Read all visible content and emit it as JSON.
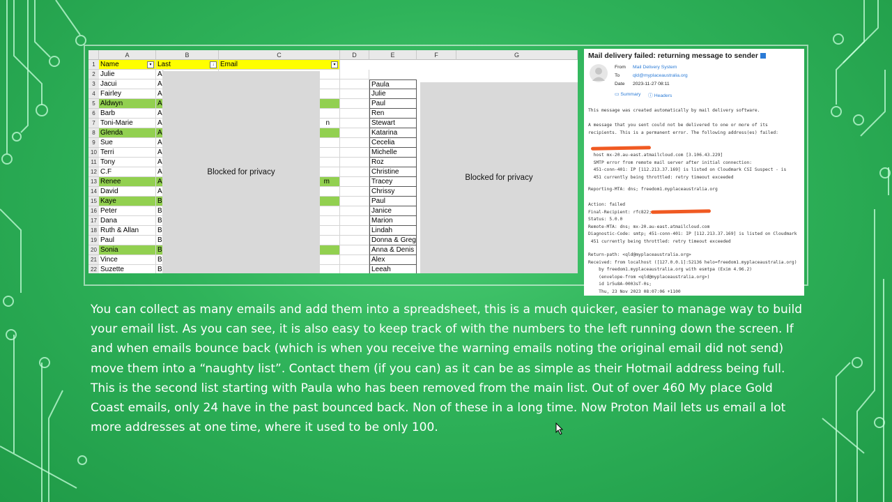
{
  "sheet": {
    "columns": [
      "A",
      "B",
      "C",
      "D",
      "E",
      "F",
      "G"
    ],
    "headers": {
      "name": "Name",
      "last": "Last",
      "email": "Email"
    },
    "rows": [
      {
        "n": "2",
        "a": "Julie",
        "b": "Al"
      },
      {
        "n": "3",
        "a": "Jacui",
        "b": "Ai"
      },
      {
        "n": "4",
        "a": "Fairley",
        "b": "Ai"
      },
      {
        "n": "5",
        "a": "Aldwyn",
        "b": "Al"
      },
      {
        "n": "6",
        "a": "Barb",
        "b": "Ar"
      },
      {
        "n": "7",
        "a": "Toni-Marie",
        "b": "Ar"
      },
      {
        "n": "8",
        "a": "Glenda",
        "b": "Ai"
      },
      {
        "n": "9",
        "a": "Sue",
        "b": "Ai"
      },
      {
        "n": "10",
        "a": "Terri",
        "b": "Ai"
      },
      {
        "n": "11",
        "a": "Tony",
        "b": "Ai"
      },
      {
        "n": "12",
        "a": "C.F",
        "b": "Ai"
      },
      {
        "n": "13",
        "a": "Renee",
        "b": "At"
      },
      {
        "n": "14",
        "a": "David",
        "b": "A"
      },
      {
        "n": "15",
        "a": "Kaye",
        "b": "B"
      },
      {
        "n": "16",
        "a": "Peter",
        "b": "B"
      },
      {
        "n": "17",
        "a": "Dana",
        "b": "B"
      },
      {
        "n": "18",
        "a": "Ruth & Allan",
        "b": "B"
      },
      {
        "n": "19",
        "a": "Paul",
        "b": "B"
      },
      {
        "n": "20",
        "a": "Sonia",
        "b": "Ba"
      },
      {
        "n": "21",
        "a": "Vince",
        "b": "B"
      },
      {
        "n": "22",
        "a": "Suzette",
        "b": "B"
      }
    ],
    "c_tail": {
      "7": "n",
      "13": "m"
    },
    "second_list": [
      "Paula",
      "Julie",
      "Paul",
      "Ren",
      "Stewart",
      "Katarina",
      "Cecelia",
      "Michelle",
      "Roz",
      "Christine",
      "Tracey",
      "Chrissy",
      "Paul",
      "Janice",
      "Marion",
      "Lindah",
      "Donna & Greg",
      "Anna & Denis",
      "Alex",
      "Leeah"
    ],
    "privacy_label": "Blocked for privacy"
  },
  "mail": {
    "title": "Mail delivery failed: returning message to sender",
    "from_label": "From",
    "from_value": "Mail Delivery System",
    "to_label": "To",
    "to_value": "qld@myplaceaustralia.org",
    "date_label": "Date",
    "date_value": "2023-11-27 08:11",
    "summary": "Summary",
    "headers": "Headers",
    "body1": "This message was created automatically by mail delivery software.",
    "body2": "A message that you sent could not be delivered to one or more of its\nrecipients. This is a permanent error. The following address(es) failed:",
    "body3": "  host mx-20.au-east.atmailcloud.com [3.106.43.229]\n  SMTP error from remote mail server after initial connection:\n  451-conn-401: IP [112.213.37.169] is listed on Cloudmark CSI Suspect - is\n  451 currently being throttled: retry timeout exceeded",
    "body4": "Reporting-MTA: dns; freedom1.myplaceaustralia.org",
    "body5": "Action: failed\nFinal-Recipient: rfc822;\nStatus: 5.0.0\nRemote-MTA: dns; mx-20.au-east.atmailcloud.com\nDiagnostic-Code: smtp; 451-conn-401: IP [112.213.37.169] is listed on Cloudmark\n 451 currently being throttled: retry timeout exceeded",
    "body6": "Return-path: <qld@myplaceaustralia.org>\nReceived: from localhost ([127.0.0.1]:52136 helo=freedom1.myplaceaustralia.org)\n    by freedom1.myplaceaustralia.org with esmtpa (Exim 4.96.2)\n    (envelope-from <qld@myplaceaustralia.org>)\n    id 1r5u8A-0003sT-0s;\n    Thu, 23 Nov 2023 08:07:06 +1100"
  },
  "paragraph": "You can collect as many emails and add them into a spreadsheet, this is a much quicker, easier to manage way to build your email list. As you can see, it is also easy to keep track of with the numbers to the left running down the screen. If and when emails bounce back (which is when you receive the warning emails noting the original email did not send) move them into a “naughty list”. Contact them (if you can) as it can be as simple as their Hotmail address being full. This is the second list starting with Paula who has been removed from the main list. Out of over 460 My place Gold Coast emails, only 24 have in the past bounced back. Non of these in a long time. Now Proton Mail lets us email a lot more addresses at one time, where it used to be only 100."
}
